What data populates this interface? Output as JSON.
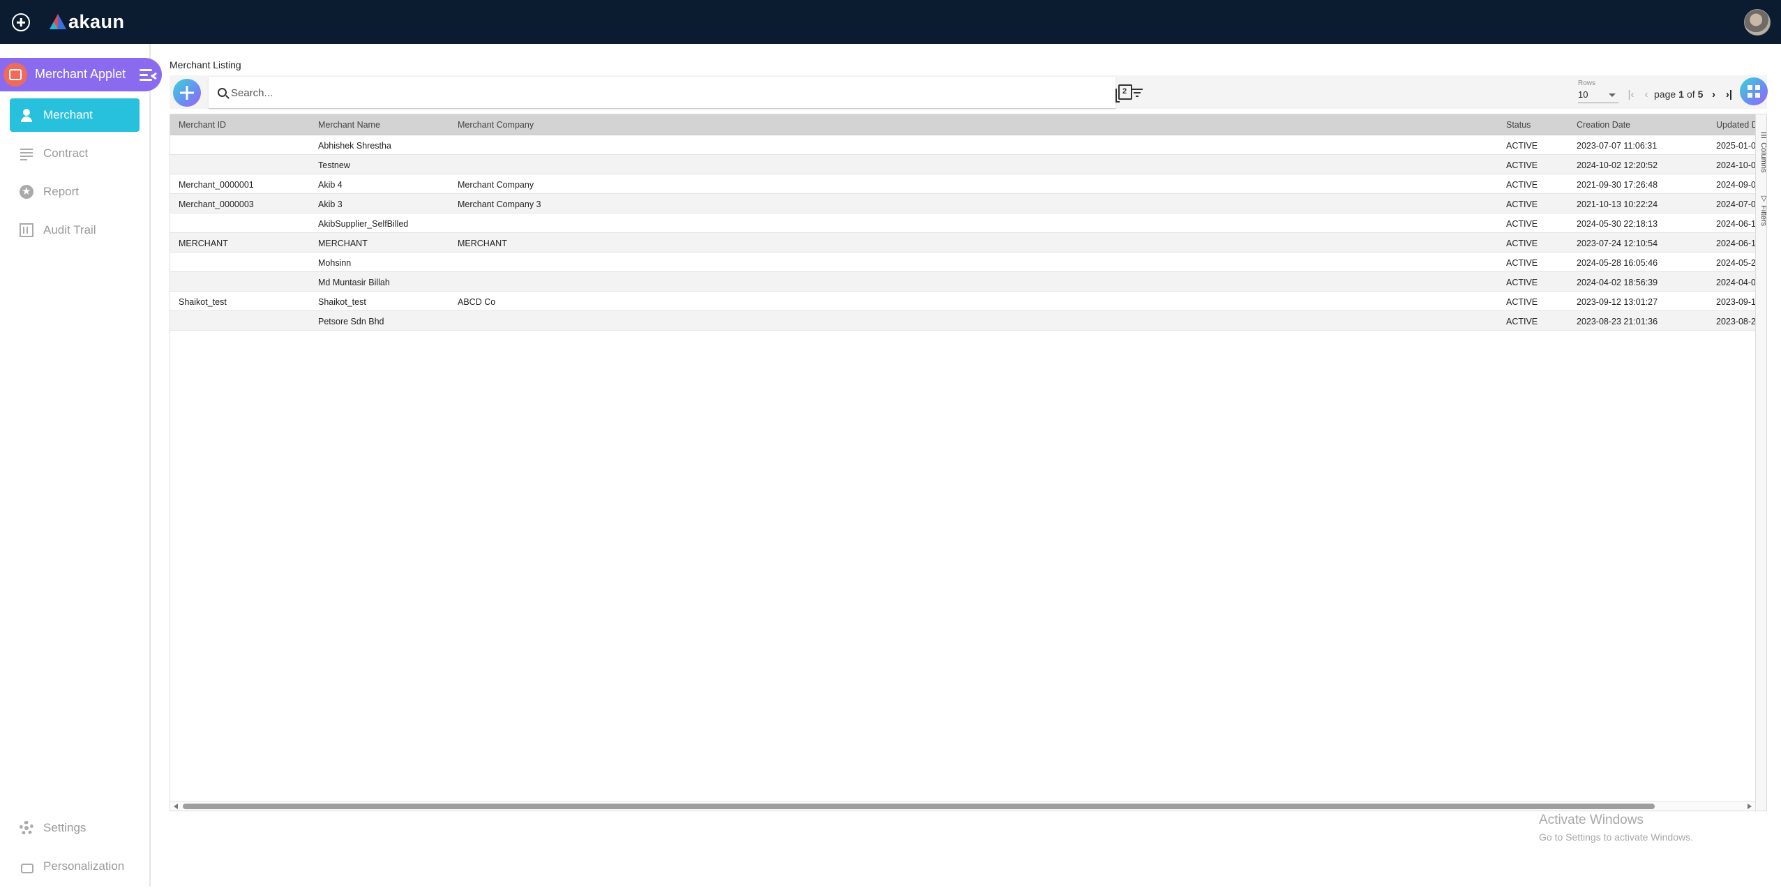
{
  "topbar": {
    "logo_text": "akaun"
  },
  "sidebar": {
    "applet_title": "Merchant Applet",
    "items": [
      {
        "label": "Merchant",
        "icon": "person-icon",
        "active": true
      },
      {
        "label": "Contract",
        "icon": "list-icon",
        "active": false
      },
      {
        "label": "Report",
        "icon": "star-icon",
        "active": false
      },
      {
        "label": "Audit Trail",
        "icon": "building-icon",
        "active": false
      }
    ],
    "bottom_items": [
      {
        "label": "Settings",
        "icon": "gear-icon"
      },
      {
        "label": "Personalization",
        "icon": "brush-icon"
      }
    ]
  },
  "main": {
    "title": "Merchant Listing",
    "search": {
      "placeholder": "Search...",
      "value": ""
    },
    "pagination": {
      "rows_label": "Rows",
      "rows_value": "10",
      "page_word": "page",
      "current_page": "1",
      "of_word": "of",
      "total_pages": "5"
    },
    "columns": [
      "Merchant ID",
      "Merchant Name",
      "Merchant Company",
      "Status",
      "Creation Date",
      "Updated D"
    ],
    "rows": [
      [
        "",
        "Abhishek Shrestha",
        "",
        "ACTIVE",
        "2023-07-07 11:06:31",
        "2025-01-0"
      ],
      [
        "",
        "Testnew",
        "",
        "ACTIVE",
        "2024-10-02 12:20:52",
        "2024-10-0"
      ],
      [
        "Merchant_0000001",
        "Akib 4",
        "Merchant Company",
        "ACTIVE",
        "2021-09-30 17:26:48",
        "2024-09-0"
      ],
      [
        "Merchant_0000003",
        "Akib 3",
        "Merchant Company 3",
        "ACTIVE",
        "2021-10-13 10:22:24",
        "2024-07-0"
      ],
      [
        "",
        "AkibSupplier_SelfBilled",
        "",
        "ACTIVE",
        "2024-05-30 22:18:13",
        "2024-06-1"
      ],
      [
        "MERCHANT",
        "MERCHANT",
        "MERCHANT",
        "ACTIVE",
        "2023-07-24 12:10:54",
        "2024-06-1"
      ],
      [
        "",
        "Mohsinn",
        "",
        "ACTIVE",
        "2024-05-28 16:05:46",
        "2024-05-2"
      ],
      [
        "",
        "Md Muntasir Billah",
        "",
        "ACTIVE",
        "2024-04-02 18:56:39",
        "2024-04-0"
      ],
      [
        "Shaikot_test",
        "Shaikot_test",
        "ABCD Co",
        "ACTIVE",
        "2023-09-12 13:01:27",
        "2023-09-1"
      ],
      [
        "",
        "Petsore Sdn Bhd",
        "",
        "ACTIVE",
        "2023-08-23 21:01:36",
        "2023-08-2"
      ]
    ],
    "side_tabs": [
      "Columns",
      "Filters"
    ]
  },
  "watermark": {
    "line1": "Activate Windows",
    "line2": "Go to Settings to activate Windows."
  },
  "colors": {
    "topbar": "#0b1c30",
    "applet": "#8a6bf0",
    "active_nav": "#27c1dd",
    "header_row": "#d3d3d3"
  }
}
